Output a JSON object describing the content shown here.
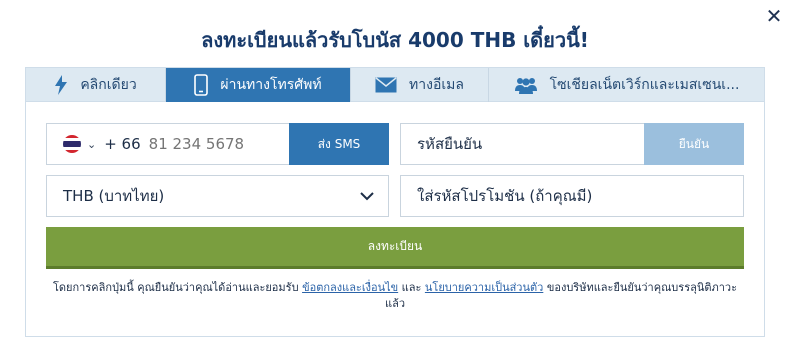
{
  "dialog": {
    "close_glyph": "✕",
    "title": "ลงทะเบียนแล้วรับโบนัส 4000 THB เดี๋ยวนี้!"
  },
  "tabs": [
    {
      "label": "คลิกเดียว",
      "icon": "lightning-icon",
      "active": false
    },
    {
      "label": "ผ่านทางโทรศัพท์",
      "icon": "phone-icon",
      "active": true
    },
    {
      "label": "ทางอีเมล",
      "icon": "envelope-icon",
      "active": false
    },
    {
      "label": "โซเชียลเน็ตเวิร์กและเมสเซนเ...",
      "icon": "users-icon",
      "active": false
    }
  ],
  "form": {
    "country_flag": "thailand-flag-icon",
    "country_code": "+ 66",
    "phone_placeholder": "81 234 5678",
    "send_sms_label": "ส่ง SMS",
    "confirm_code_placeholder": "รหัสยืนยัน",
    "confirm_label": "ยืนยัน",
    "currency_value": "THB (บาทไทย)",
    "promo_placeholder": "ใส่รหัสโปรโมชัน (ถ้าคุณมี)",
    "register_label": "ลงทะเบียน"
  },
  "terms": {
    "prefix": "โดยการคลิกปุ่มนี้ คุณยืนยันว่าคุณได้อ่านและยอมรับ ",
    "link1": "ข้อตกลงและเงื่อนไข",
    "middle": " และ ",
    "link2": "นโยบายความเป็นส่วนตัว",
    "suffix": " ของบริษัทและยืนยันว่าคุณบรรลุนิติภาวะแล้ว"
  },
  "colors": {
    "accent": "#2f75b2",
    "confirm_disabled": "#9bbfdd",
    "register_green": "#7a9e3f",
    "title_blue": "#193b6b",
    "tab_bar": "#dde9f2"
  }
}
